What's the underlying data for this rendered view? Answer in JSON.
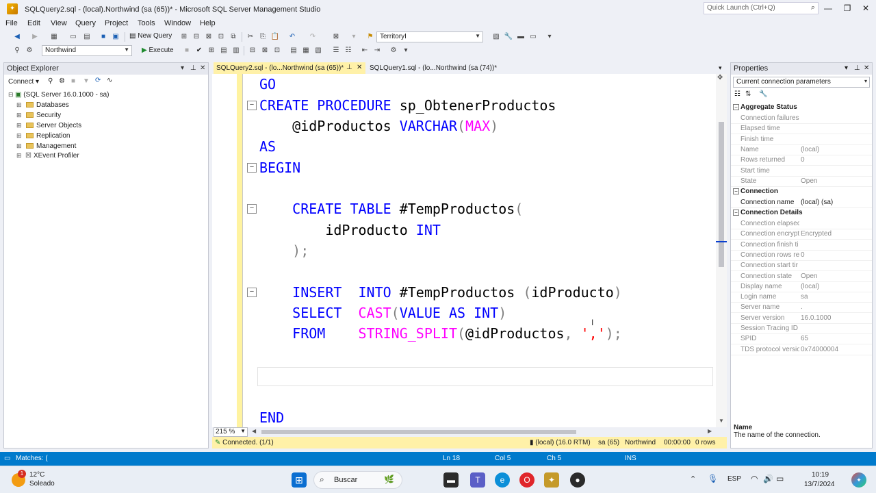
{
  "window": {
    "title": "SQLQuery2.sql - (local).Northwind (sa (65))* - Microsoft SQL Server Management Studio",
    "quick_launch_placeholder": "Quick Launch (Ctrl+Q)"
  },
  "menu": [
    "File",
    "Edit",
    "View",
    "Query",
    "Project",
    "Tools",
    "Window",
    "Help"
  ],
  "toolbar": {
    "new_query_label": "New Query",
    "territory_combo": "TerritoryI",
    "database_combo": "Northwind",
    "execute_label": "Execute"
  },
  "object_explorer": {
    "title": "Object Explorer",
    "connect_label": "Connect",
    "server_node": "(SQL Server 16.0.1000 - sa)",
    "nodes": [
      "Databases",
      "Security",
      "Server Objects",
      "Replication",
      "Management",
      "XEvent Profiler"
    ]
  },
  "tabs": [
    {
      "label": "SQLQuery2.sql - (lo...Northwind (sa (65))*",
      "active": true
    },
    {
      "label": "SQLQuery1.sql - (lo...Northwind (sa (74))*",
      "active": false
    }
  ],
  "editor": {
    "lines": {
      "go": "GO",
      "create_kw": "CREATE PROCEDURE",
      "proc_name": " sp_ObtenerProductos",
      "param": "    @idProductos ",
      "varchar": "VARCHAR",
      "lparen": "(",
      "max": "MAX",
      "rparen": ")",
      "as": "AS",
      "begin": "BEGIN",
      "create_table_kw": "    CREATE TABLE",
      "temp_table": " #TempProductos",
      "ct_paren": "(",
      "col_name": "        idProducto ",
      "col_type": "INT",
      "close_paren": "    );",
      "insert_kw": "    INSERT  INTO",
      "insert_tbl": " #TempProductos ",
      "insert_col_open": "(",
      "insert_col": "idProducto",
      "insert_col_close": ")",
      "select_kw": "    SELECT  ",
      "cast_fn": "CAST",
      "cast_open": "(",
      "cast_body": "VALUE AS INT",
      "cast_close": ")",
      "from_kw": "    FROM    ",
      "split_fn": "STRING_SPLIT",
      "split_open": "(",
      "split_arg": "@idProductos",
      "split_comma": ", ",
      "split_str": "','",
      "split_close": ");",
      "end": "END"
    }
  },
  "zoom": "215 %",
  "connection_bar": {
    "status": "Connected. (1/1)",
    "server": "(local) (16.0 RTM)",
    "user": "sa (65)",
    "database": "Northwind",
    "elapsed": "00:00:00",
    "rows": "0 rows"
  },
  "properties": {
    "title": "Properties",
    "selector": "Current connection parameters",
    "categories": {
      "aggregate": "Aggregate Status",
      "connection": "Connection",
      "details": "Connection Details"
    },
    "aggregate_rows": [
      {
        "name": "Connection failures",
        "value": ""
      },
      {
        "name": "Elapsed time",
        "value": ""
      },
      {
        "name": "Finish time",
        "value": ""
      },
      {
        "name": "Name",
        "value": "(local)"
      },
      {
        "name": "Rows returned",
        "value": "0"
      },
      {
        "name": "Start time",
        "value": ""
      },
      {
        "name": "State",
        "value": "Open"
      }
    ],
    "connection_rows": [
      {
        "name": "Connection name",
        "value": "(local) (sa)"
      }
    ],
    "detail_rows": [
      {
        "name": "Connection elapsed",
        "value": ""
      },
      {
        "name": "Connection encrypt",
        "value": "Encrypted"
      },
      {
        "name": "Connection finish ti",
        "value": ""
      },
      {
        "name": "Connection rows re",
        "value": "0"
      },
      {
        "name": "Connection start tir",
        "value": ""
      },
      {
        "name": "Connection state",
        "value": "Open"
      },
      {
        "name": "Display name",
        "value": "(local)"
      },
      {
        "name": "Login name",
        "value": "sa"
      },
      {
        "name": "Server name",
        "value": "."
      },
      {
        "name": "Server version",
        "value": "16.0.1000"
      },
      {
        "name": "Session Tracing ID",
        "value": ""
      },
      {
        "name": "SPID",
        "value": "65"
      },
      {
        "name": "TDS protocol versio",
        "value": "0x74000004"
      }
    ],
    "desc_title": "Name",
    "desc_text": "The name of the connection."
  },
  "statusbar": {
    "matches": "Matches: (",
    "line": "Ln 18",
    "col": "Col 5",
    "ch": "Ch 5",
    "mode": "INS"
  },
  "taskbar": {
    "weather_temp": "12°C",
    "weather_desc": "Soleado",
    "weather_badge": "1",
    "search_label": "Buscar",
    "language": "ESP",
    "time": "10:19",
    "date": "13/7/2024"
  },
  "colors": {
    "keyword": "#0000ff",
    "function": "#ff00ff",
    "string": "#ff0000",
    "status_bar": "#007acc",
    "active_tab": "#fff1a8"
  }
}
